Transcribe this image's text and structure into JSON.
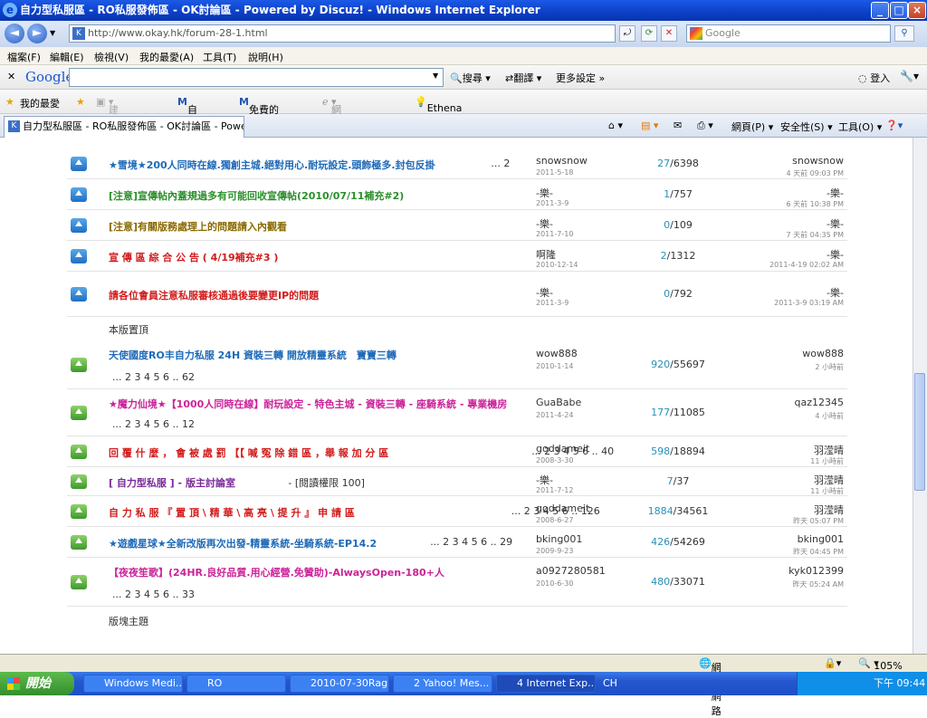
{
  "window": {
    "title": "自力型私服區 - RO私服發佈區 - OK討論區 - Powered by Discuz! - Windows Internet Explorer"
  },
  "address": {
    "url": "http://www.okay.hk/forum-28-1.html",
    "search_placeholder": "Google"
  },
  "menu": [
    "檔案(F)",
    "編輯(E)",
    "檢視(V)",
    "我的最愛(A)",
    "工具(T)",
    "說明(H)"
  ],
  "google_toolbar": {
    "logo": "Google",
    "search_label": "搜尋",
    "translate_label": "翻譯",
    "more_label": "更多設定",
    "login_label": "登入"
  },
  "favorites": {
    "label": "我的最愛",
    "items": [
      "建議的網站",
      "自訂連結",
      "免費的 Hotmail",
      "網頁快訊圖庫",
      "Ethena腳本區【新】- RO..."
    ]
  },
  "tab": {
    "label": "自力型私服區 - RO私服發佈區 - OK討論區 - Power..."
  },
  "commands": [
    "網頁(P)",
    "安全性(S)",
    "工具(O)"
  ],
  "threads_top": [
    {
      "title": "★雪境★200人同時在線.獨創主城.絕對用心.耐玩設定.頭飾極多.封包反掛",
      "pages": "... 2",
      "author": "snowsnow",
      "date": "2011-5-18",
      "replies": "27",
      "views": "6398",
      "last": "snowsnow",
      "last_time": "4 天前 09:03 PM",
      "color": "c-blue"
    },
    {
      "title": "[注意]宣傳帖內蓋規過多有可能回收宣傳帖(2010/07/11補充#2)",
      "pages": "",
      "author": "-樂-",
      "date": "2011-3-9",
      "replies": "1",
      "views": "757",
      "last": "-樂-",
      "last_time": "6 天前 10:38 PM",
      "color": "c-green"
    },
    {
      "title": "[注意]有關版務處理上的問題請入內觀看",
      "pages": "",
      "author": "-樂-",
      "date": "2011-7-10",
      "replies": "0",
      "views": "109",
      "last": "-樂-",
      "last_time": "7 天前 04:35 PM",
      "color": "c-olive"
    },
    {
      "title": "宣 傳 區 綜 合 公 告 ( 4/19補充#3 )",
      "pages": "",
      "author": "啊隆",
      "date": "2010-12-14",
      "replies": "2",
      "views": "1312",
      "last": "-樂-",
      "last_time": "2011-4-19 02:02 AM",
      "color": "c-red"
    },
    {
      "title": "請各位會員注意私服審核通過後要變更IP的問題",
      "pages": "",
      "author": "-樂-",
      "date": "2011-3-9",
      "replies": "0",
      "views": "792",
      "last": "-樂-",
      "last_time": "2011-3-9 03:19 AM",
      "color": "c-red"
    }
  ],
  "section_pinned": "本版置頂",
  "threads_pinned": [
    {
      "title": "天使國度RO丰自力私服 24H 資裝三轉 開放精靈系統　寶寶三轉",
      "pages": "... 2 3 4 5 6 .. 62",
      "author": "wow888",
      "date": "2010-1-14",
      "replies": "920",
      "views": "55697",
      "last": "wow888",
      "last_time": "2 小時前",
      "color": "c-blue"
    },
    {
      "title": "★魔力仙境★【1000人同時在線】耐玩設定 - 特色主城 - 資裝三轉 - 座騎系統 - 專業機房",
      "pages": "... 2 3 4 5 6 .. 12",
      "author": "GuaBabe",
      "date": "2011-4-24",
      "replies": "177",
      "views": "11085",
      "last": "qaz12345",
      "last_time": "4 小時前",
      "color": "c-pink"
    },
    {
      "title": "回 覆 什 麼 ， 會 被 處 罰 【【 喊 冤 除 錯 區 ，舉 報 加 分 區",
      "pages": "... 2 3 4 5 6 .. 40",
      "author": "goddameit",
      "date": "2008-3-30",
      "replies": "598",
      "views": "18894",
      "last": "羽滢晴",
      "last_time": "11 小時前",
      "color": "c-red"
    },
    {
      "title": "[ 自力型私服 ] - 版主討論室",
      "pages": "- [閱讀權限 100]",
      "author": "-樂-",
      "date": "2011-7-12",
      "replies": "7",
      "views": "37",
      "last": "羽滢晴",
      "last_time": "11 小時前",
      "color": "c-purple"
    },
    {
      "title": "自 力 私 服 『 置 頂 \\ 精 華 \\ 高 亮 \\ 提 升 』 申 請 區",
      "pages": "... 2 3 4 5 6 .. 126",
      "author": "goddameit",
      "date": "2008-6-27",
      "replies": "1884",
      "views": "34561",
      "last": "羽滢晴",
      "last_time": "昨天 05:07 PM",
      "color": "c-red"
    },
    {
      "title": "★遊戲星球★全新改版再次出發-精靈系統-坐騎系統-EP14.2",
      "pages": "... 2 3 4 5 6 .. 29",
      "author": "bking001",
      "date": "2009-9-23",
      "replies": "426",
      "views": "54269",
      "last": "bking001",
      "last_time": "昨天 04:45 PM",
      "color": "c-blue"
    },
    {
      "title": "【夜夜笙歌】(24HR.良好品質.用心經營.免贊助)-AlwaysOpen-180+人",
      "pages": "... 2 3 4 5 6 .. 33",
      "author": "a0927280581",
      "date": "2010-6-30",
      "replies": "480",
      "views": "33071",
      "last": "kyk012399",
      "last_time": "昨天 05:24 AM",
      "color": "c-pink"
    }
  ],
  "section_normal": "版塊主題",
  "status": {
    "zone": "網際網路",
    "zoom": "105%"
  },
  "taskbar": {
    "start": "開始",
    "tasks": [
      "Windows Medi...",
      "RO",
      "2010-07-30Rag...",
      "2 Yahoo! Mes...",
      "4 Internet Exp..."
    ],
    "lang": "CH",
    "clock": "下午 09:44"
  }
}
